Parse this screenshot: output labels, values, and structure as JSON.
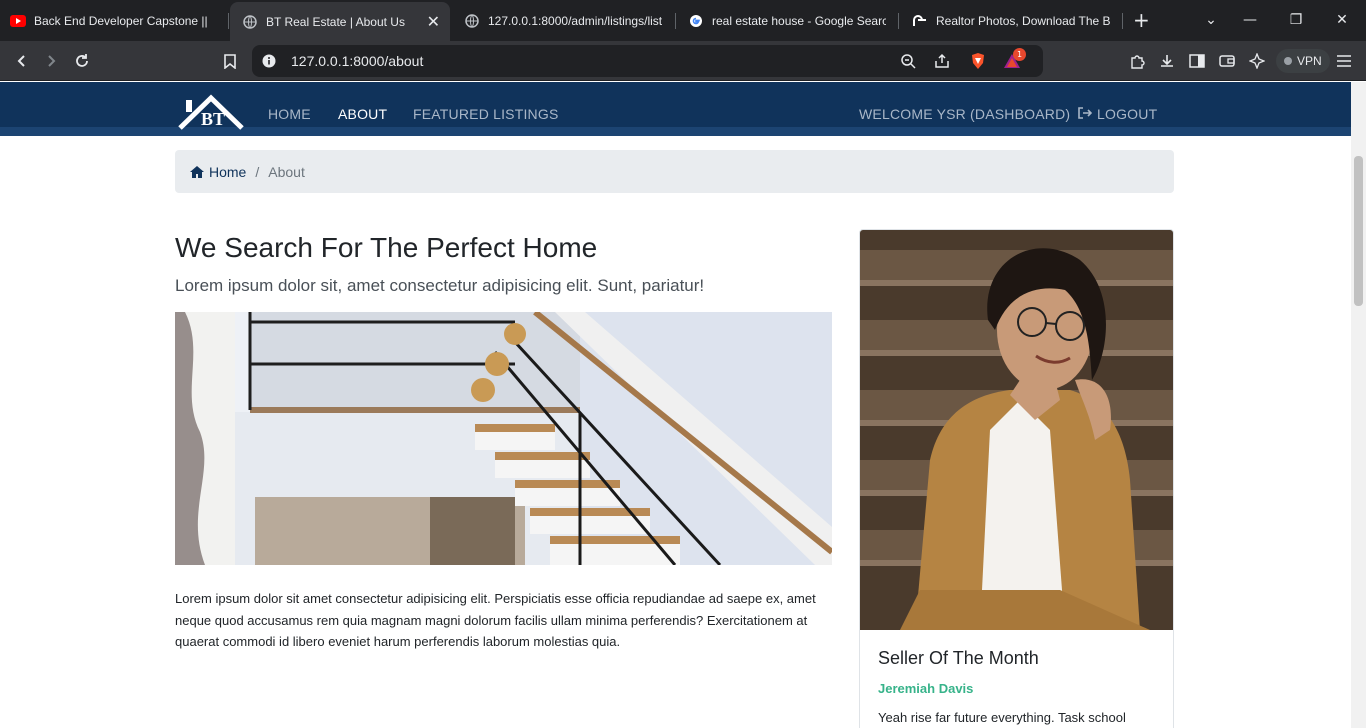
{
  "browser": {
    "tabs": [
      {
        "title": "Back End Developer Capstone || B",
        "icon": "youtube-icon"
      },
      {
        "title": "BT Real Estate | About Us",
        "icon": "globe-icon",
        "active": true
      },
      {
        "title": "127.0.0.1:8000/admin/listings/list",
        "icon": "globe-icon"
      },
      {
        "title": "real estate house - Google Search",
        "icon": "google-icon"
      },
      {
        "title": "Realtor Photos, Download The BE",
        "icon": "realtor-icon"
      }
    ],
    "url": "127.0.0.1:8000/about",
    "vpn_label": "VPN",
    "notification_count": "1"
  },
  "navbar": {
    "logo_text": "BT",
    "links": {
      "home": "HOME",
      "about": "ABOUT",
      "featured": "FEATURED LISTINGS",
      "welcome": "WELCOME YSR (DASHBOARD)",
      "logout": "LOGOUT"
    },
    "colors": {
      "background": "#10335b",
      "active": "#ffffff",
      "inactive": "#a9b7c8"
    }
  },
  "breadcrumb": {
    "home": "Home",
    "separator": "/",
    "current": "About"
  },
  "about": {
    "title": "We Search For The Perfect Home",
    "lead": "Lorem ipsum dolor sit, amet consectetur adipisicing elit. Sunt, pariatur!",
    "body": "Lorem ipsum dolor sit amet consectetur adipisicing elit. Perspiciatis esse officia repudiandae ad saepe ex, amet neque quod accusamus rem quia magnam magni dolorum facilis ullam minima perferendis? Exercitationem at quaerat commodi id libero eveniet harum perferendis laborum molestias quia."
  },
  "seller_card": {
    "title": "Seller Of The Month",
    "name": "Jeremiah Davis",
    "text": "Yeah rise far future everything. Task school",
    "name_color": "#37b38a"
  }
}
